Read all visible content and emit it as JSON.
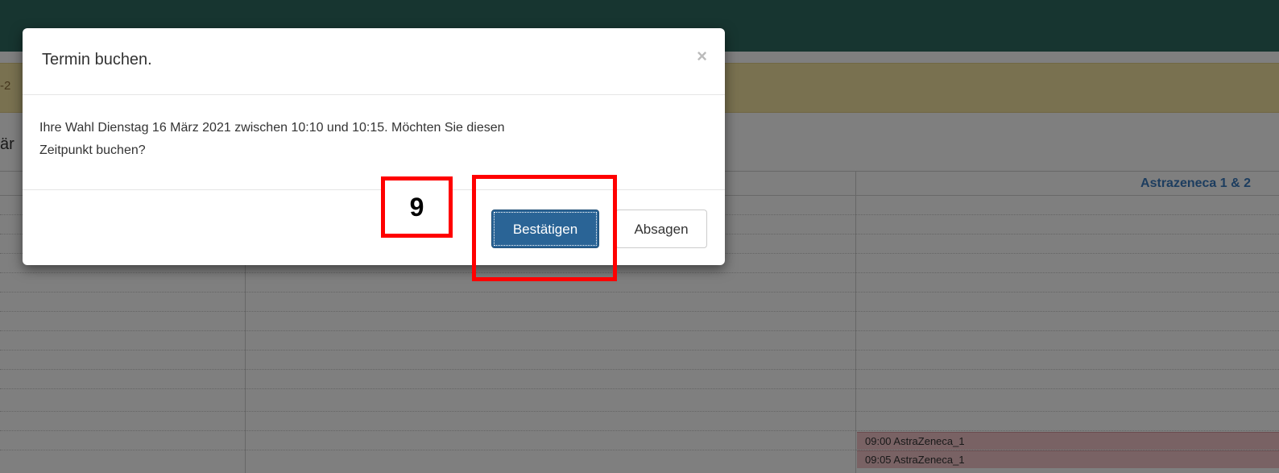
{
  "background": {
    "alert_text_fragment": "-2",
    "heading_fragment": "är",
    "column_header": "Astrazeneca 1 & 2",
    "slots": [
      "09:00 AstraZeneca_1",
      "09:05 AstraZeneca_1"
    ]
  },
  "modal": {
    "title": "Termin buchen.",
    "close_symbol": "×",
    "body_line1": "Ihre Wahl Dienstag 16 März 2021 zwischen 10:10 und 10:15. Möchten Sie diesen",
    "body_line2": "Zeitpunkt buchen?",
    "confirm_label": "Bestätigen",
    "cancel_label": "Absagen"
  },
  "annotation": {
    "step_number": "9"
  },
  "colors": {
    "header_bar": "#2e6b61",
    "alert_bar": "#f3e2a0",
    "primary_button": "#2a6496",
    "slot_booked": "#f2c4c9",
    "annotation": "#ff0000"
  }
}
